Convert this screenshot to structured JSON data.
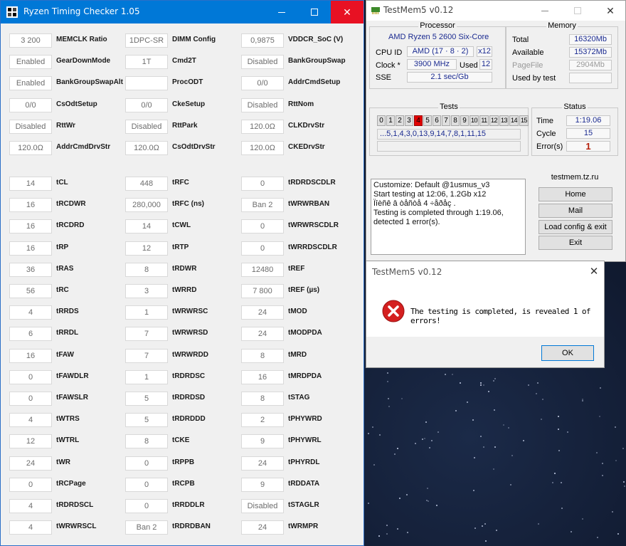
{
  "rtc": {
    "title": "Ryzen Timing Checker 1.05",
    "rows_top": [
      [
        [
          "3 200",
          "MEMCLK Ratio"
        ],
        [
          "1DPC-SR",
          "DIMM Config"
        ],
        [
          "0,9875",
          "VDDCR_SoC (V)"
        ]
      ],
      [
        [
          "Enabled",
          "GearDownMode"
        ],
        [
          "1T",
          "Cmd2T"
        ],
        [
          "Disabled",
          "BankGroupSwap"
        ]
      ],
      [
        [
          "Enabled",
          "BankGroupSwapAlt"
        ],
        [
          "",
          "ProcODT"
        ],
        [
          "0/0",
          "AddrCmdSetup"
        ]
      ],
      [
        [
          "0/0",
          "CsOdtSetup"
        ],
        [
          "0/0",
          "CkeSetup"
        ],
        [
          "Disabled",
          "RttNom"
        ]
      ],
      [
        [
          "Disabled",
          "RttWr"
        ],
        [
          "Disabled",
          "RttPark"
        ],
        [
          "120.0Ω",
          "CLKDrvStr"
        ]
      ],
      [
        [
          "120.0Ω",
          "AddrCmdDrvStr"
        ],
        [
          "120.0Ω",
          "CsOdtDrvStr"
        ],
        [
          "120.0Ω",
          "CKEDrvStr"
        ]
      ]
    ],
    "rows_bottom": [
      [
        [
          "14",
          "tCL"
        ],
        [
          "448",
          "tRFC"
        ],
        [
          "0",
          "tRDRDSCDLR"
        ]
      ],
      [
        [
          "16",
          "tRCDWR"
        ],
        [
          "280,000",
          "tRFC (ns)"
        ],
        [
          "Ban 2",
          "tWRWRBAN"
        ]
      ],
      [
        [
          "16",
          "tRCDRD"
        ],
        [
          "14",
          "tCWL"
        ],
        [
          "0",
          "tWRWRSCDLR"
        ]
      ],
      [
        [
          "16",
          "tRP"
        ],
        [
          "12",
          "tRTP"
        ],
        [
          "0",
          "tWRRDSCDLR"
        ]
      ],
      [
        [
          "36",
          "tRAS"
        ],
        [
          "8",
          "tRDWR"
        ],
        [
          "12480",
          "tREF"
        ]
      ],
      [
        [
          "56",
          "tRC"
        ],
        [
          "3",
          "tWRRD"
        ],
        [
          "7 800",
          "tREF (µs)"
        ]
      ],
      [
        [
          "4",
          "tRRDS"
        ],
        [
          "1",
          "tWRWRSC"
        ],
        [
          "24",
          "tMOD"
        ]
      ],
      [
        [
          "6",
          "tRRDL"
        ],
        [
          "7",
          "tWRWRSD"
        ],
        [
          "24",
          "tMODPDA"
        ]
      ],
      [
        [
          "16",
          "tFAW"
        ],
        [
          "7",
          "tWRWRDD"
        ],
        [
          "8",
          "tMRD"
        ]
      ],
      [
        [
          "0",
          "tFAWDLR"
        ],
        [
          "1",
          "tRDRDSC"
        ],
        [
          "16",
          "tMRDPDA"
        ]
      ],
      [
        [
          "0",
          "tFAWSLR"
        ],
        [
          "5",
          "tRDRDSD"
        ],
        [
          "8",
          "tSTAG"
        ]
      ],
      [
        [
          "4",
          "tWTRS"
        ],
        [
          "5",
          "tRDRDDD"
        ],
        [
          "2",
          "tPHYWRD"
        ]
      ],
      [
        [
          "12",
          "tWTRL"
        ],
        [
          "8",
          "tCKE"
        ],
        [
          "9",
          "tPHYWRL"
        ]
      ],
      [
        [
          "24",
          "tWR"
        ],
        [
          "0",
          "tRPPB"
        ],
        [
          "24",
          "tPHYRDL"
        ]
      ],
      [
        [
          "0",
          "tRCPage"
        ],
        [
          "0",
          "tRCPB"
        ],
        [
          "9",
          "tRDDATA"
        ]
      ],
      [
        [
          "4",
          "tRDRDSCL"
        ],
        [
          "0",
          "tRRDDLR"
        ],
        [
          "Disabled",
          "tSTAGLR"
        ]
      ],
      [
        [
          "4",
          "tWRWRSCL"
        ],
        [
          "Ban 2",
          "tRDRDBAN"
        ],
        [
          "24",
          "tWRMPR"
        ]
      ]
    ]
  },
  "tm5": {
    "title": "TestMem5 v0.12",
    "processor": {
      "group_title": "Processor",
      "name": "AMD Ryzen 5 2600 Six-Core",
      "cpuid_label": "CPU ID",
      "cpuid_value": "AMD  (17 · 8 · 2)",
      "threads": "x12",
      "clock_label": "Clock *",
      "clock_value": "3900 MHz",
      "used_label": "Used",
      "used_value": "12",
      "sse_label": "SSE",
      "sse_value": "2.1 sec/Gb"
    },
    "memory": {
      "group_title": "Memory",
      "total_label": "Total",
      "total_value": "16320Mb",
      "available_label": "Available",
      "available_value": "15372Mb",
      "pagefile_label": "PageFile",
      "pagefile_value": "2904Mb",
      "usedbytest_label": "Used by test",
      "usedbytest_value": ""
    },
    "tests": {
      "group_title": "Tests",
      "cells": [
        "0",
        "1",
        "2",
        "3",
        "4",
        "5",
        "6",
        "7",
        "8",
        "9",
        "10",
        "11",
        "12",
        "13",
        "14",
        "15"
      ],
      "error_cell": "4",
      "sequence": "...5,1,4,3,0,13,9,14,7,8,1,11,15",
      "progress_fraction": 0
    },
    "status": {
      "group_title": "Status",
      "time_label": "Time",
      "time_value": "1:19.06",
      "cycle_label": "Cycle",
      "cycle_value": "15",
      "errors_label": "Error(s)",
      "errors_value": "1"
    },
    "log_lines": [
      "Customize: Default @1usmus_v3",
      "Start testing at 12:06, 1.2Gb x12",
      "Ïîèñê â òåñòå 4 ÷åðåç .",
      "Testing is completed through 1:19.06,",
      "detected 1 error(s)."
    ],
    "site": "testmem.tz.ru",
    "buttons": [
      "Home",
      "Mail",
      "Load config & exit",
      "Exit"
    ]
  },
  "dialog": {
    "title": "TestMem5 v0.12",
    "message": "The testing is completed, is revealed 1 of errors!",
    "ok_label": "OK"
  },
  "colors": {
    "rtc_titlebar": "#0078d7",
    "close_red": "#e81123",
    "value_blue": "#1a2a90",
    "error_red": "#e00000"
  }
}
